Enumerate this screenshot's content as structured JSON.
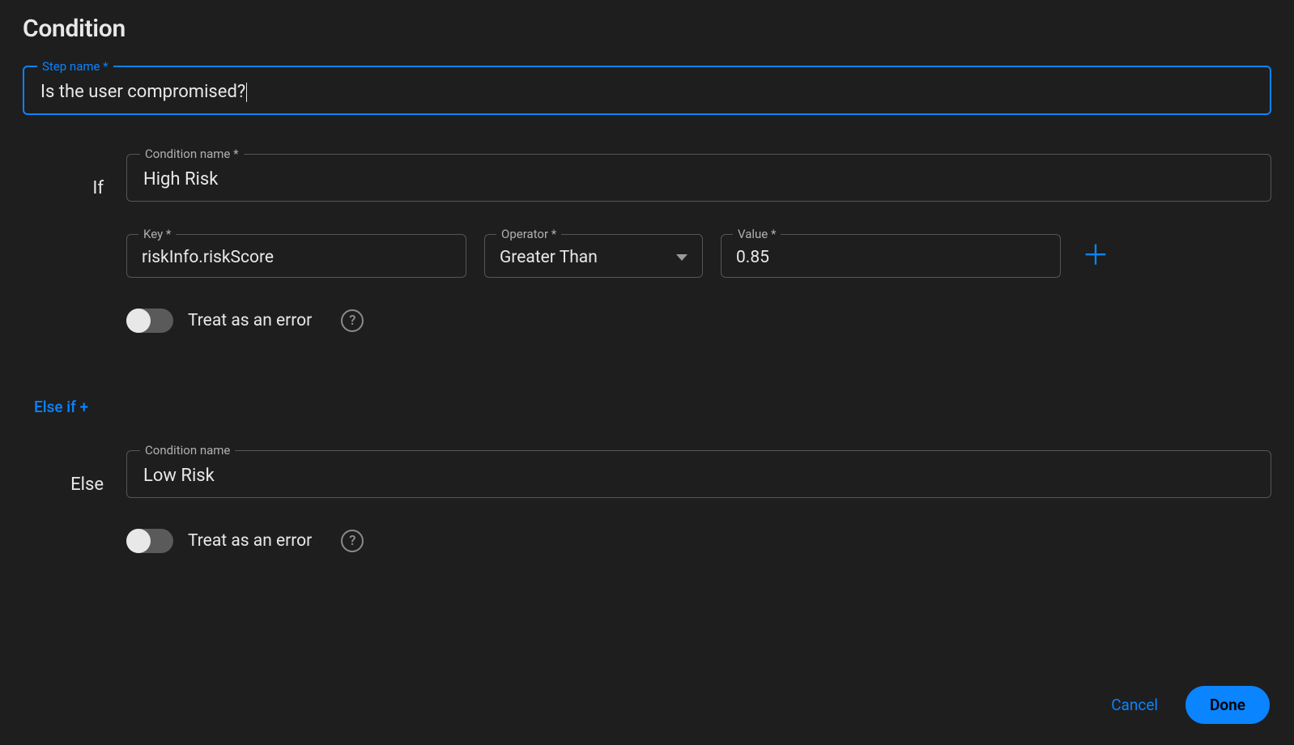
{
  "title": "Condition",
  "step_name": {
    "label": "Step name *",
    "value": "Is the user compromised?"
  },
  "if_section": {
    "label": "If",
    "condition_name": {
      "label": "Condition name *",
      "value": "High Risk"
    },
    "key": {
      "label": "Key *",
      "value": "riskInfo.riskScore"
    },
    "operator": {
      "label": "Operator *",
      "value": "Greater Than"
    },
    "value": {
      "label": "Value *",
      "value": "0.85"
    },
    "treat_as_error_label": "Treat as an error"
  },
  "else_if_link": "Else if +",
  "else_section": {
    "label": "Else",
    "condition_name": {
      "label": "Condition name",
      "value": "Low Risk"
    },
    "treat_as_error_label": "Treat as an error"
  },
  "footer": {
    "cancel": "Cancel",
    "done": "Done"
  },
  "colors": {
    "accent": "#0a84ff",
    "bg": "#1e1e1e"
  }
}
